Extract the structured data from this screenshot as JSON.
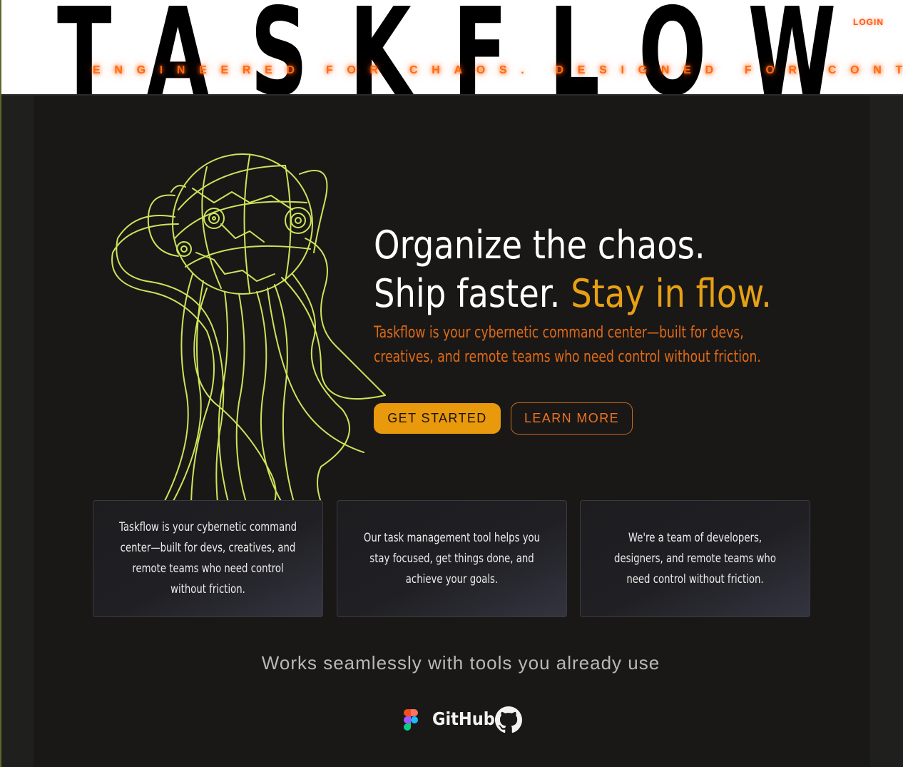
{
  "header": {
    "logo_text": "TASKFLOW",
    "tagline": "ENGINEERED FOR CHAOS. DESIGNED FOR CONTROL.",
    "login_label": "LOGIN"
  },
  "hero": {
    "headline_line1": "Organize the chaos.",
    "headline_line2_a": "Ship faster. ",
    "headline_line2_b": "Stay in flow.",
    "description_line1": "Taskflow is your cybernetic command center—built for devs,",
    "description_line2": "creatives, and remote teams who need control without friction.",
    "primary_cta": "GET STARTED",
    "secondary_cta": "LEARN MORE"
  },
  "features": [
    {
      "text": "Taskflow is your cybernetic command center—built for devs, creatives, and remote teams who need control without friction."
    },
    {
      "text": "Our task management tool helps you stay focused, get things done, and achieve your goals."
    },
    {
      "text": "We're a team of developers, designers, and remote teams who need control without friction."
    }
  ],
  "integrations": {
    "heading": "Works seamlessly with tools you already use",
    "tools": [
      {
        "name": "figma-icon"
      },
      {
        "name": "github-wordmark",
        "label": "GitHub"
      },
      {
        "name": "github-icon"
      }
    ]
  },
  "colors": {
    "accent_orange": "#e8990c",
    "tagline_orange": "#ff6a10",
    "robot_lime": "#cde45a",
    "panel_bg": "#191817"
  }
}
